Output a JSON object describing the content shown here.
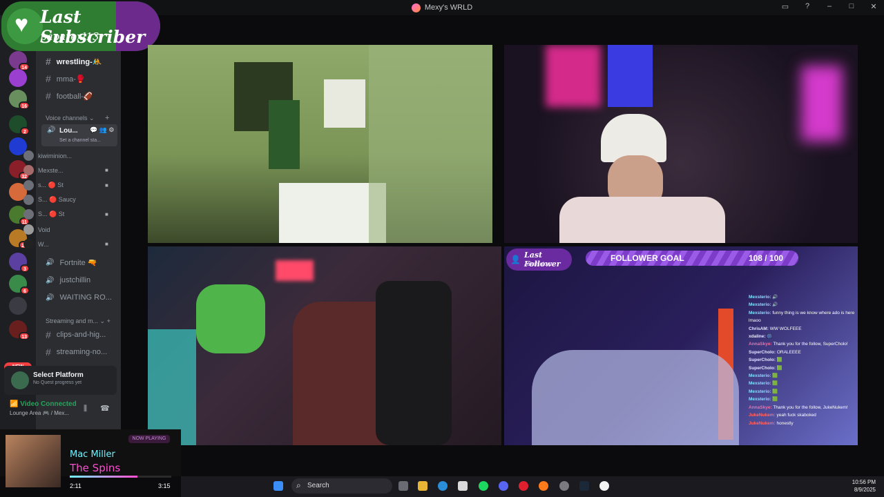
{
  "window": {
    "title": "Mexy's WRLD",
    "controls": [
      "▭",
      "?",
      "–",
      "□",
      "✕"
    ]
  },
  "subscriber": {
    "title": "Last Subscriber",
    "name": "paparexl13"
  },
  "servers": [
    {
      "badge": "14"
    },
    {
      "badge": ""
    },
    {
      "badge": "16"
    },
    {
      "badge": "2"
    },
    {
      "badge": ""
    },
    {
      "badge": "32"
    },
    {
      "badge": ""
    },
    {
      "badge": "11"
    },
    {
      "badge": "29"
    },
    {
      "badge": "3"
    },
    {
      "badge": "6"
    },
    {
      "badge": ""
    },
    {
      "badge": "13"
    }
  ],
  "new_badge": "NEW",
  "channels": {
    "text_top": [
      {
        "label": "wrestling-🤼"
      },
      {
        "label": "mma-🥊"
      },
      {
        "label": "football-🏈"
      }
    ],
    "voice_category": "Voice channels",
    "active_voice": {
      "label": "Lou...",
      "status": "Set a channel sta..."
    },
    "voice_users": [
      {
        "name": "kiwiminion..."
      },
      {
        "name": "Mexste..."
      },
      {
        "name": "s... 🔴 St"
      },
      {
        "name": "S... 🔴 Saucy"
      },
      {
        "name": "S... 🔴 St"
      },
      {
        "name": "Void"
      },
      {
        "name": "W..."
      }
    ],
    "voice_channels": [
      {
        "label": "Fortnite 🔫"
      },
      {
        "label": "justchillin"
      },
      {
        "label": "WAITING RO..."
      }
    ],
    "stream_category": "Streaming and m...",
    "text_bottom": [
      {
        "label": "clips-and-hig..."
      },
      {
        "label": "streaming-no..."
      }
    ]
  },
  "platform": {
    "title": "Select Platform",
    "subtitle": "No Quest progress yet"
  },
  "voice_status": {
    "connected": "Video Connected",
    "location": "Lounge Area 🎮 / Mex..."
  },
  "last_follower": {
    "title": "Last Follower",
    "name": "JukeNukem"
  },
  "follower_goal": {
    "label": "FOLLOWER GOAL",
    "current": 108,
    "target": 100,
    "display": "108 / 100",
    "progress": 1.0
  },
  "chat": [
    {
      "user": "Mexsterio:",
      "text": "🔊"
    },
    {
      "user": "Mexsterio:",
      "text": "🔊"
    },
    {
      "user": "Mexsterio:",
      "text": "funny thing is we know where ado is here lmaoo"
    },
    {
      "user": "ChrisAM:",
      "text": "WW WOLFEEE"
    },
    {
      "user": "xdaline:",
      "text": "🎆"
    },
    {
      "user": "AnnaSkye:",
      "text": "Thank you for the follow, SuperCholo!"
    },
    {
      "user": "SuperCholo:",
      "text": "ORALEEEE"
    },
    {
      "user": "SuperCholo:",
      "text": "🟩"
    },
    {
      "user": "SuperCholo:",
      "text": "🟩"
    },
    {
      "user": "Mexsterio:",
      "text": "🟩"
    },
    {
      "user": "Mexsterio:",
      "text": "🟩"
    },
    {
      "user": "Mexsterio:",
      "text": "🟩"
    },
    {
      "user": "Mexsterio:",
      "text": "🟩"
    },
    {
      "user": "AnnaSkye:",
      "text": "Thank you for the follow, JukeNukem!"
    },
    {
      "user": "JukeNukem:",
      "text": "yeah fuck skaboked"
    },
    {
      "user": "JukeNukem:",
      "text": "honestly"
    }
  ],
  "music": {
    "tag": "NOW PLAYING",
    "artist": "Mac Miller",
    "song": "The Spins",
    "elapsed": "2:11",
    "total": "3:15",
    "progress": 0.67
  },
  "taskbar": {
    "search": "Search",
    "time": "10:56 PM",
    "date": "8/9/2025"
  }
}
